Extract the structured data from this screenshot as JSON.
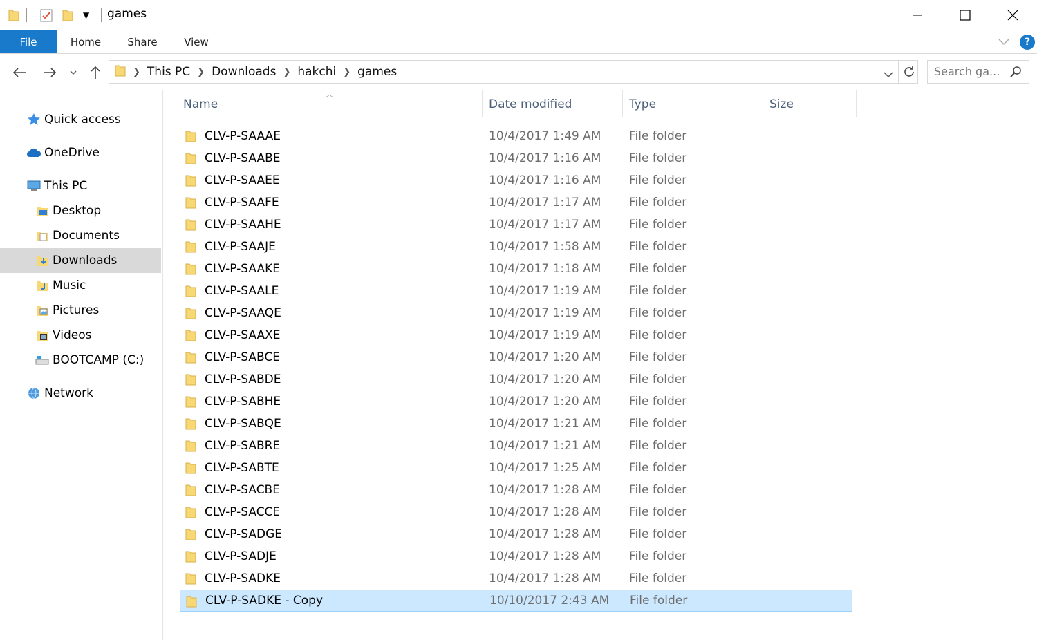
{
  "window": {
    "title": "games",
    "controls": {
      "minimize": "minimize-icon",
      "maximize": "maximize-icon",
      "close": "close-icon"
    }
  },
  "ribbon": {
    "tabs": [
      "File",
      "Home",
      "Share",
      "View"
    ],
    "accent": "#1979ca"
  },
  "address": {
    "crumbs": [
      "This PC",
      "Downloads",
      "hakchi",
      "games"
    ],
    "search_placeholder": "Search ga..."
  },
  "nav": {
    "items": [
      {
        "label": "Quick access",
        "icon": "star-icon"
      },
      {
        "label": "OneDrive",
        "icon": "cloud-icon"
      },
      {
        "label": "This PC",
        "icon": "computer-icon"
      },
      {
        "label": "Desktop",
        "icon": "desktop-folder-icon"
      },
      {
        "label": "Documents",
        "icon": "documents-folder-icon"
      },
      {
        "label": "Downloads",
        "icon": "downloads-folder-icon",
        "selected": true
      },
      {
        "label": "Music",
        "icon": "music-folder-icon"
      },
      {
        "label": "Pictures",
        "icon": "pictures-folder-icon"
      },
      {
        "label": "Videos",
        "icon": "videos-folder-icon"
      },
      {
        "label": "BOOTCAMP (C:)",
        "icon": "drive-icon"
      },
      {
        "label": "Network",
        "icon": "network-icon"
      }
    ]
  },
  "columns": [
    "Name",
    "Date modified",
    "Type",
    "Size"
  ],
  "files": [
    {
      "name": "CLV-P-SAAAE",
      "date": "10/4/2017 1:49 AM",
      "type": "File folder"
    },
    {
      "name": "CLV-P-SAABE",
      "date": "10/4/2017 1:16 AM",
      "type": "File folder"
    },
    {
      "name": "CLV-P-SAAEE",
      "date": "10/4/2017 1:16 AM",
      "type": "File folder"
    },
    {
      "name": "CLV-P-SAAFE",
      "date": "10/4/2017 1:17 AM",
      "type": "File folder"
    },
    {
      "name": "CLV-P-SAAHE",
      "date": "10/4/2017 1:17 AM",
      "type": "File folder"
    },
    {
      "name": "CLV-P-SAAJE",
      "date": "10/4/2017 1:58 AM",
      "type": "File folder"
    },
    {
      "name": "CLV-P-SAAKE",
      "date": "10/4/2017 1:18 AM",
      "type": "File folder"
    },
    {
      "name": "CLV-P-SAALE",
      "date": "10/4/2017 1:19 AM",
      "type": "File folder"
    },
    {
      "name": "CLV-P-SAAQE",
      "date": "10/4/2017 1:19 AM",
      "type": "File folder"
    },
    {
      "name": "CLV-P-SAAXE",
      "date": "10/4/2017 1:19 AM",
      "type": "File folder"
    },
    {
      "name": "CLV-P-SABCE",
      "date": "10/4/2017 1:20 AM",
      "type": "File folder"
    },
    {
      "name": "CLV-P-SABDE",
      "date": "10/4/2017 1:20 AM",
      "type": "File folder"
    },
    {
      "name": "CLV-P-SABHE",
      "date": "10/4/2017 1:20 AM",
      "type": "File folder"
    },
    {
      "name": "CLV-P-SABQE",
      "date": "10/4/2017 1:21 AM",
      "type": "File folder"
    },
    {
      "name": "CLV-P-SABRE",
      "date": "10/4/2017 1:21 AM",
      "type": "File folder"
    },
    {
      "name": "CLV-P-SABTE",
      "date": "10/4/2017 1:25 AM",
      "type": "File folder"
    },
    {
      "name": "CLV-P-SACBE",
      "date": "10/4/2017 1:28 AM",
      "type": "File folder"
    },
    {
      "name": "CLV-P-SACCE",
      "date": "10/4/2017 1:28 AM",
      "type": "File folder"
    },
    {
      "name": "CLV-P-SADGE",
      "date": "10/4/2017 1:28 AM",
      "type": "File folder"
    },
    {
      "name": "CLV-P-SADJE",
      "date": "10/4/2017 1:28 AM",
      "type": "File folder"
    },
    {
      "name": "CLV-P-SADKE",
      "date": "10/4/2017 1:28 AM",
      "type": "File folder"
    },
    {
      "name": "CLV-P-SADKE - Copy",
      "date": "10/10/2017 2:43 AM",
      "type": "File folder",
      "selected": true
    }
  ],
  "colors": {
    "folder": "#f8d775",
    "selection": "#cce8ff",
    "nav_selected": "#d9d9d9",
    "help": "#1979ca"
  }
}
